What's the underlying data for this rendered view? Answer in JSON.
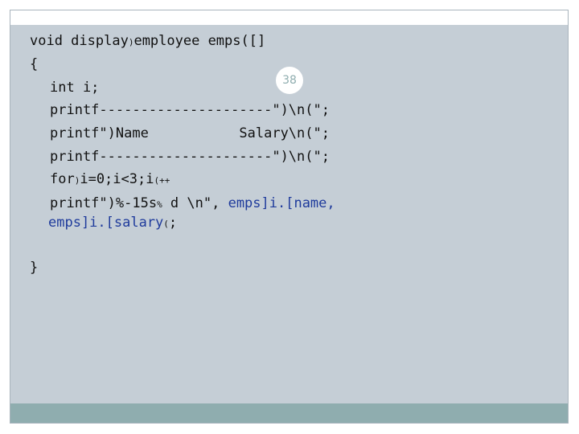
{
  "slide": {
    "page_number": "38",
    "code": {
      "l1": "void display",
      "l1_sym": ")",
      "l1_rest": "employee emps([]",
      "l2": "{",
      "l3": "int i;",
      "l4": "printf---------------------\")\\n(\";",
      "l5": "printf\")Name           Salary\\n(\";",
      "l6": "printf---------------------\")\\n(\";",
      "l7_a": "for",
      "l7_sym1": ")",
      "l7_b": "i=0;i<3;i",
      "l7_sym2": "(++",
      "l8_a": "printf\")%-15s",
      "l8_sym": "%",
      "l8_b": " d \\n\", ",
      "l8_blue": "emps]i.[name,",
      "l9_blue": "emps]i.[salary",
      "l9_sym": "(",
      "l9_end": ";",
      "l10": "}"
    }
  }
}
